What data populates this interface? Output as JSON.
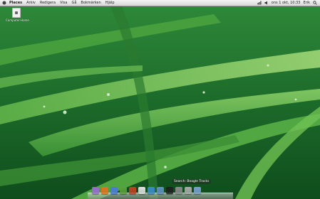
{
  "menubar": {
    "app_name": "Places",
    "menus": [
      "Arkiv",
      "Redigera",
      "Visa",
      "Gå",
      "Bokmärken",
      "Hjälp"
    ],
    "clock": "ons 1 okt, 10:33",
    "user": "Erik"
  },
  "desktop": {
    "icons": [
      {
        "label": "Computer-Home",
        "icon": "file-icon"
      }
    ]
  },
  "dock": {
    "tooltip": "Search: Beagle Tracks",
    "items": [
      {
        "name": "finder-icon",
        "color": "#9a6ad0"
      },
      {
        "name": "firefox-icon",
        "color": "#e07020"
      },
      {
        "name": "mail-icon",
        "color": "#4a7ad8"
      },
      {
        "name": "chat-icon",
        "color": "#5aa03a"
      },
      {
        "name": "music-icon",
        "color": "#c04020"
      },
      {
        "name": "document-icon",
        "color": "#e0e0e0"
      },
      {
        "name": "globe-icon",
        "color": "#3a8ac8"
      },
      {
        "name": "image-icon",
        "color": "#6090c0"
      },
      {
        "name": "terminal-icon",
        "color": "#202020"
      },
      {
        "name": "system-monitor-icon",
        "color": "#8a8a8a"
      },
      {
        "name": "trash-icon",
        "color": "#aaaaaa"
      },
      {
        "name": "folder-icon",
        "color": "#7aa0d0"
      }
    ]
  }
}
